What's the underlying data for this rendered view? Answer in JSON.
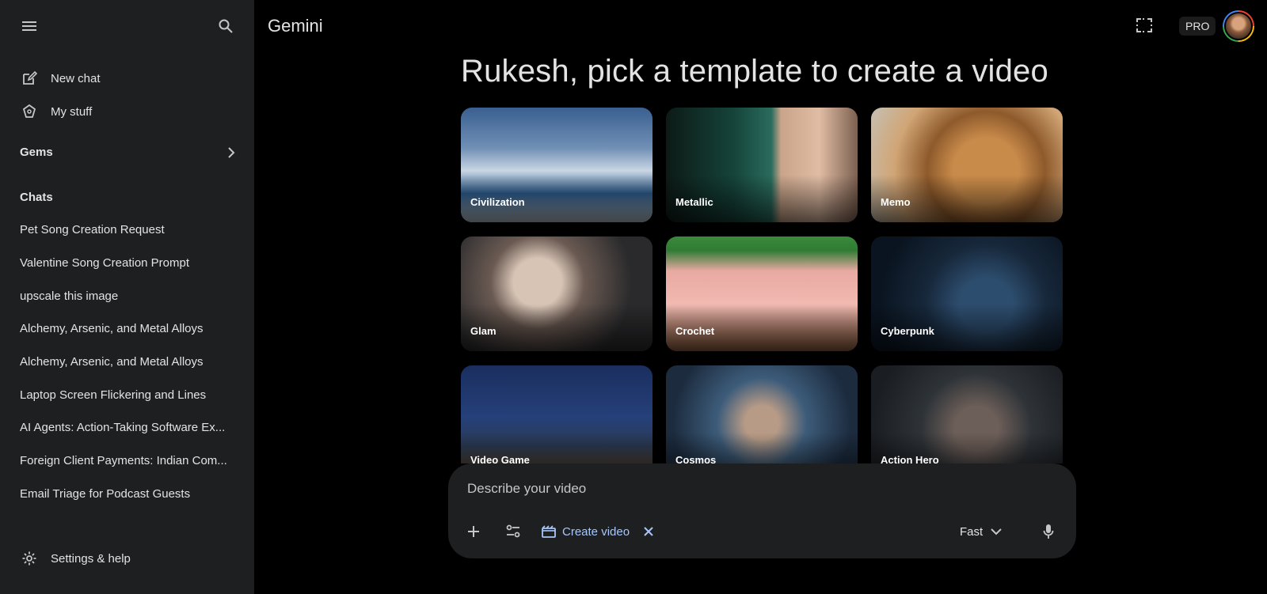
{
  "app": {
    "title": "Gemini"
  },
  "sidebar": {
    "new_chat": "New chat",
    "my_stuff": "My stuff",
    "gems": "Gems",
    "chats_title": "Chats",
    "chats": [
      "Pet Song Creation Request",
      "Valentine Song Creation Prompt",
      "upscale this image",
      "Alchemy, Arsenic, and Metal Alloys",
      "Alchemy, Arsenic, and Metal Alloys",
      "Laptop Screen Flickering and Lines",
      "AI Agents: Action-Taking Software Ex...",
      "Foreign Client Payments: Indian Com...",
      "Email Triage for Podcast Guests"
    ],
    "settings": "Settings & help"
  },
  "header": {
    "plan_badge": "PRO"
  },
  "main": {
    "heading": "Rukesh, pick a template to create a video",
    "templates": [
      "Civilization",
      "Metallic",
      "Memo",
      "Glam",
      "Crochet",
      "Cyberpunk",
      "Video Game",
      "Cosmos",
      "Action Hero"
    ]
  },
  "prompt": {
    "placeholder": "Describe your video",
    "chip_label": "Create video",
    "mode": "Fast"
  },
  "colors": {
    "background": "#000000",
    "sidebar": "#1e1f20",
    "accent_chip": "#a8c7fa",
    "text": "#e3e3e3"
  }
}
